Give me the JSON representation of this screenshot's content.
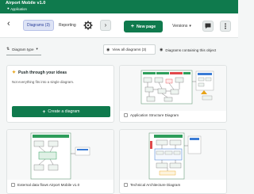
{
  "header": {
    "title": "Airport Mobile v1.0",
    "subtitle": "Application",
    "subtitle_icon": "app-icon",
    "bg_color": "#0f7a4d"
  },
  "toolbar": {
    "back_icon": "chevron-left-icon",
    "tabs": [
      {
        "label": "Diagrams (3)",
        "active": true
      },
      {
        "label": "Reporting",
        "active": false
      }
    ],
    "settings_icon": "gear-icon",
    "forward_icon": "chevron-right-icon",
    "new_page_label": "New page",
    "versions_label": "Versions",
    "comment_icon": "comment-icon",
    "more_icon": "more-vertical-icon"
  },
  "filters": {
    "type_label": "Diagram type",
    "all_label": "View all diagrams (3)",
    "containing_label": "Diagrams containing this object"
  },
  "promo": {
    "title": "Push through your ideas",
    "text": "Not everything fits into a single diagram.",
    "button_label": "Create a diagram"
  },
  "diagrams": [
    {
      "name": "Application Structure Diagram"
    },
    {
      "name": "External data flows Airport Mobile v1.0"
    },
    {
      "name": "Technical Architecture Diagram"
    }
  ],
  "colors": {
    "accent": "#0f7a4d",
    "tab_active_bg": "#dde3f5",
    "diagram_green": "#2e9e5b",
    "diagram_red": "#e0484b",
    "diagram_blue": "#3a7bd5"
  }
}
